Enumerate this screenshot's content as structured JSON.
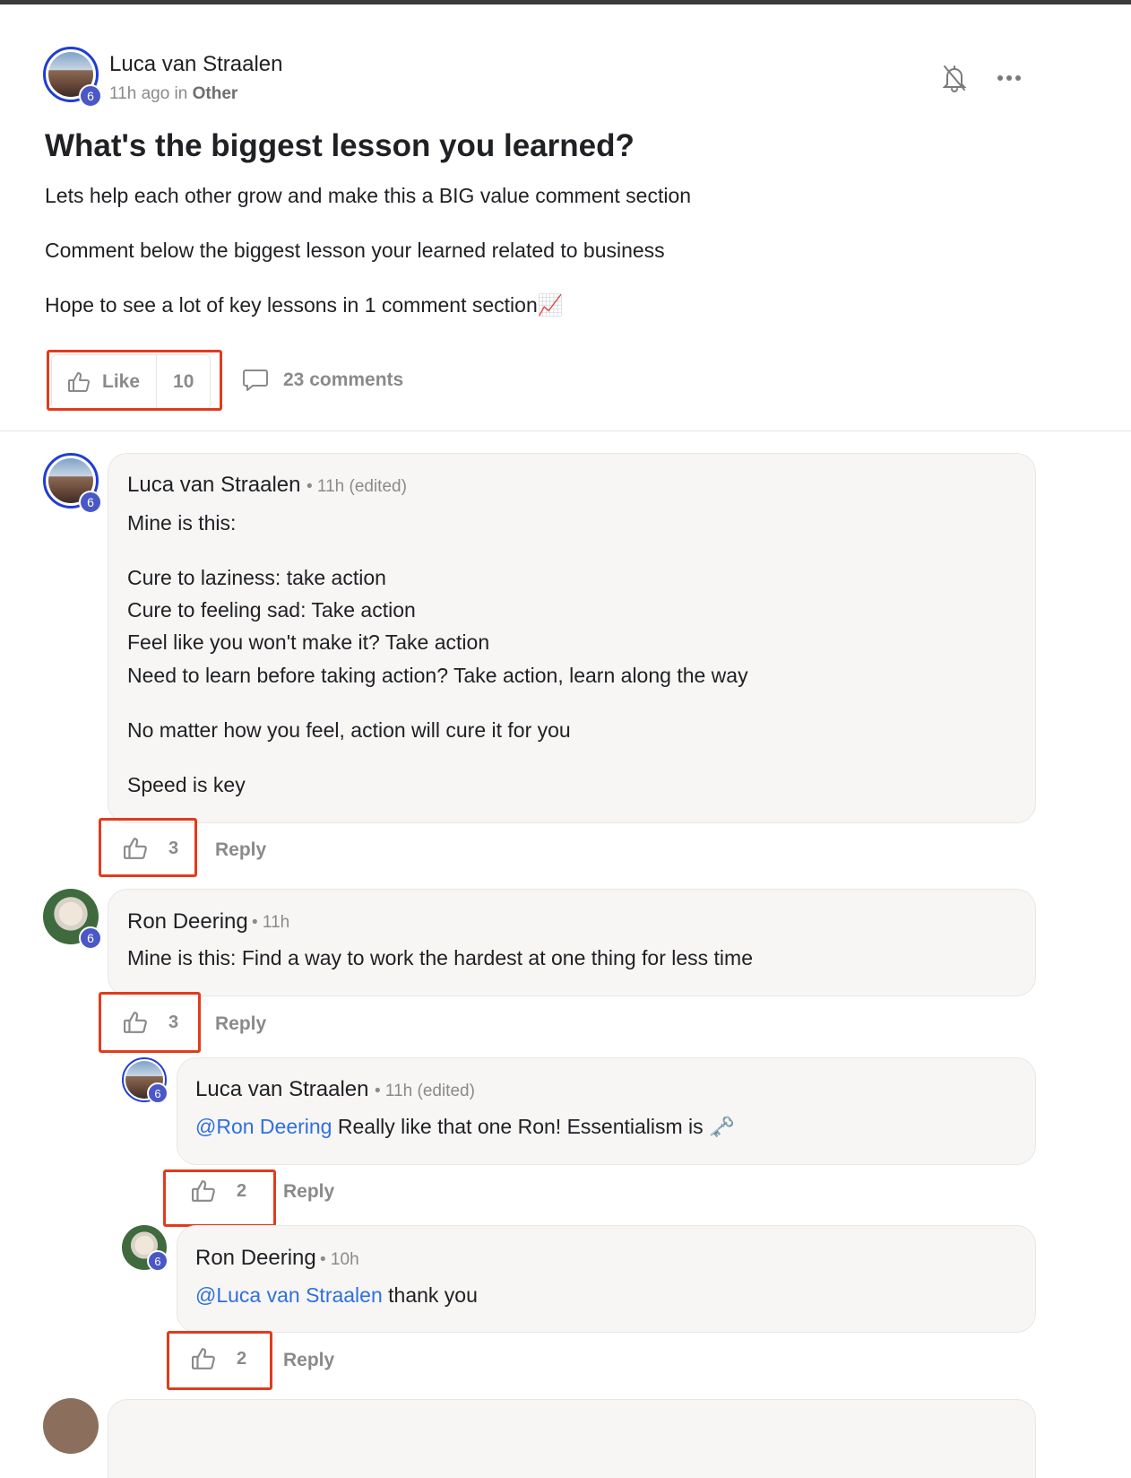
{
  "post": {
    "author": "Luca van Straalen",
    "avatar_level": "6",
    "time": "11h ago in ",
    "category": "Other",
    "title": "What's the biggest lesson you learned?",
    "body": [
      "Lets help each other grow and make this a BIG value comment section",
      "Comment below the biggest lesson your learned related to business",
      "Hope to see a lot of key lessons in 1 comment section📈"
    ],
    "like_label": "Like",
    "like_count": "10",
    "comments_label": "23 comments"
  },
  "comments": [
    {
      "author": "Luca van Straalen",
      "level": "6",
      "meta": "• 11h (edited)",
      "lines": [
        "Mine is this:",
        "Cure to laziness: take action",
        "Cure to feeling sad: Take action",
        "Feel like you won't make it? Take action",
        "Need to learn before taking action? Take action, learn along the way",
        "No matter how you feel, action will cure it for you",
        "Speed is key"
      ],
      "likes": "3",
      "reply_label": "Reply"
    },
    {
      "author": "Ron Deering",
      "level": "6",
      "meta": "• 11h",
      "lines": [
        "Mine is this: Find a way to work the hardest at one thing for less time"
      ],
      "likes": "3",
      "reply_label": "Reply"
    }
  ],
  "replies": [
    {
      "author": "Luca van Straalen",
      "level": "6",
      "meta": "• 11h (edited)",
      "mention": "@Ron Deering",
      "text": " Really like that one Ron! Essentialism is 🗝️",
      "likes": "2",
      "reply_label": "Reply"
    },
    {
      "author": "Ron Deering",
      "level": "6",
      "meta": "• 10h",
      "mention": "@Luca van Straalen",
      "text": " thank you",
      "likes": "2",
      "reply_label": "Reply"
    }
  ],
  "icons": {
    "notify": "bell-off-icon",
    "more": "more-horizontal-icon",
    "like": "thumbs-up-icon",
    "comment": "comment-bubble-icon"
  },
  "colors": {
    "highlight": "#e23b1c",
    "mention": "#2f6fe0",
    "level_badge": "#4a57c6",
    "avatar_ring": "#1f3dd6"
  }
}
